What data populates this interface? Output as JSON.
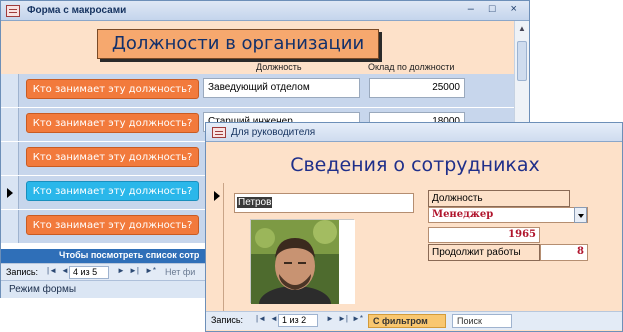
{
  "form1": {
    "title": "Форма с макросами",
    "window_buttons": "– □ ×",
    "heading": "Должности в организации",
    "columns": {
      "position": "Должность",
      "salary": "Оклад по должности"
    },
    "button_label": "Кто занимает эту должность?",
    "rows": [
      {
        "position": "Заведующий отделом",
        "salary": "25000"
      },
      {
        "position": "Старший инженер",
        "salary": "18000"
      },
      {
        "position": "",
        "salary": ""
      },
      {
        "position": "",
        "salary": ""
      },
      {
        "position": "",
        "salary": ""
      }
    ],
    "footer_text": "Чтобы посмотреть список сотр",
    "nav": {
      "label": "Запись:",
      "first": "|◄",
      "prev": "◄",
      "record": "4 из 5",
      "next": "►",
      "last": "►|",
      "new": "►*",
      "filter": "Нет фи"
    },
    "status": "Режим формы"
  },
  "form2": {
    "title": "Для руководителя",
    "heading": "Сведения о сотрудниках",
    "name": "Петров",
    "position_label": "Должность",
    "position_value": "Менеджер",
    "year": "1965",
    "continue_label": "Продолжит работы",
    "continue_value": "8",
    "nav": {
      "label": "Запись:",
      "first": "|◄",
      "prev": "◄",
      "record": "1 из 2",
      "next": "►",
      "last": "►|",
      "new": "►*",
      "filter": "С фильтром",
      "search": "Поиск"
    }
  },
  "colors": {
    "orange_button": "#f27a3c",
    "active_button": "#2ab7ea",
    "form_background": "#fde1c9",
    "heading_blue": "#1f2f8a",
    "value_red": "#b0142c"
  }
}
